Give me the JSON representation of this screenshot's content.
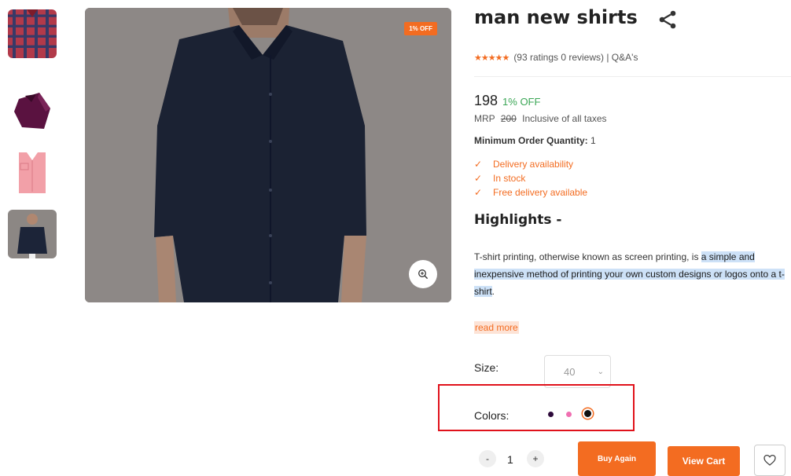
{
  "gallery": {
    "thumbnails": [
      {
        "icon": "red-checked-shirt-thumbnail"
      },
      {
        "icon": "purple-folded-shirt-thumbnail"
      },
      {
        "icon": "pink-folded-shirt-thumbnail"
      },
      {
        "icon": "navy-shirt-model-thumbnail",
        "selected": true
      }
    ],
    "main_image_icon": "navy-shirt-model-photo",
    "discount_badge": "1% OFF",
    "zoom_icon": "zoom-in-icon"
  },
  "product": {
    "title": "man new shirts",
    "share_icon": "share-icon",
    "rating_stars": 5,
    "ratings_text": "(93 ratings 0 reviews) | Q&A's",
    "price": "198",
    "discount": "1% OFF",
    "mrp_label": "MRP",
    "mrp_value": "200",
    "tax_note": "Inclusive of all taxes",
    "moq_label": "Minimum Order Quantity:",
    "moq_value": "1",
    "features": [
      "Delivery availability",
      "In stock",
      "Free delivery available"
    ],
    "highlights_title": "Highlights -",
    "description_plain": "T-shirt printing, otherwise known as screen printing, is ",
    "description_highlighted": "a simple and inexpensive method of printing your own custom designs or logos onto a t-shirt",
    "description_end": ".",
    "read_more": "read more"
  },
  "options": {
    "size_label": "Size:",
    "size_value": "40",
    "colors_label": "Colors:",
    "colors": [
      "#2d0a3a",
      "#f06fb1",
      "#111111"
    ],
    "selected_color_index": 2
  },
  "actions": {
    "qty_minus": "-",
    "qty_value": "1",
    "qty_plus": "+",
    "buy_again": "Buy Again",
    "view_cart": "View Cart",
    "wishlist_icon": "heart-icon"
  },
  "colors": {
    "accent": "#f36c21",
    "success": "#3aa655",
    "highlight_box": "#e0121b",
    "text_highlight": "#cde1f7"
  }
}
